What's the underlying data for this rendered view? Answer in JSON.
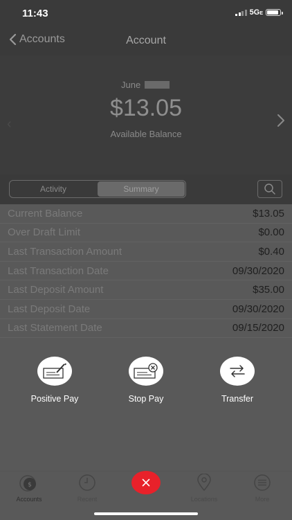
{
  "status_bar": {
    "time": "11:43",
    "network": "5G",
    "network_suffix": "E"
  },
  "nav": {
    "back_label": "Accounts",
    "title": "Account"
  },
  "hero": {
    "month": "June",
    "balance": "$13.05",
    "balance_label": "Available Balance"
  },
  "segments": [
    {
      "label": "Activity",
      "active": false
    },
    {
      "label": "Summary",
      "active": true
    }
  ],
  "summary_rows": [
    {
      "label": "Current Balance",
      "value": "$13.05"
    },
    {
      "label": "Over Draft Limit",
      "value": "$0.00"
    },
    {
      "label": "Last Transaction Amount",
      "value": "$0.40"
    },
    {
      "label": "Last Transaction Date",
      "value": "09/30/2020"
    },
    {
      "label": "Last Deposit Amount",
      "value": "$35.00"
    },
    {
      "label": "Last Deposit Date",
      "value": "09/30/2020"
    },
    {
      "label": "Last Statement Date",
      "value": "09/15/2020"
    }
  ],
  "actions": [
    {
      "label": "Positive Pay",
      "icon": "check-pen-icon"
    },
    {
      "label": "Stop Pay",
      "icon": "check-cancel-icon"
    },
    {
      "label": "Transfer",
      "icon": "transfer-arrows-icon"
    }
  ],
  "bottom_nav": {
    "accounts": "Accounts",
    "recent": "Recent",
    "locations": "Locations",
    "more": "More",
    "badge": "$"
  },
  "colors": {
    "close_button": "#e8212a",
    "overlay": "#595959"
  }
}
